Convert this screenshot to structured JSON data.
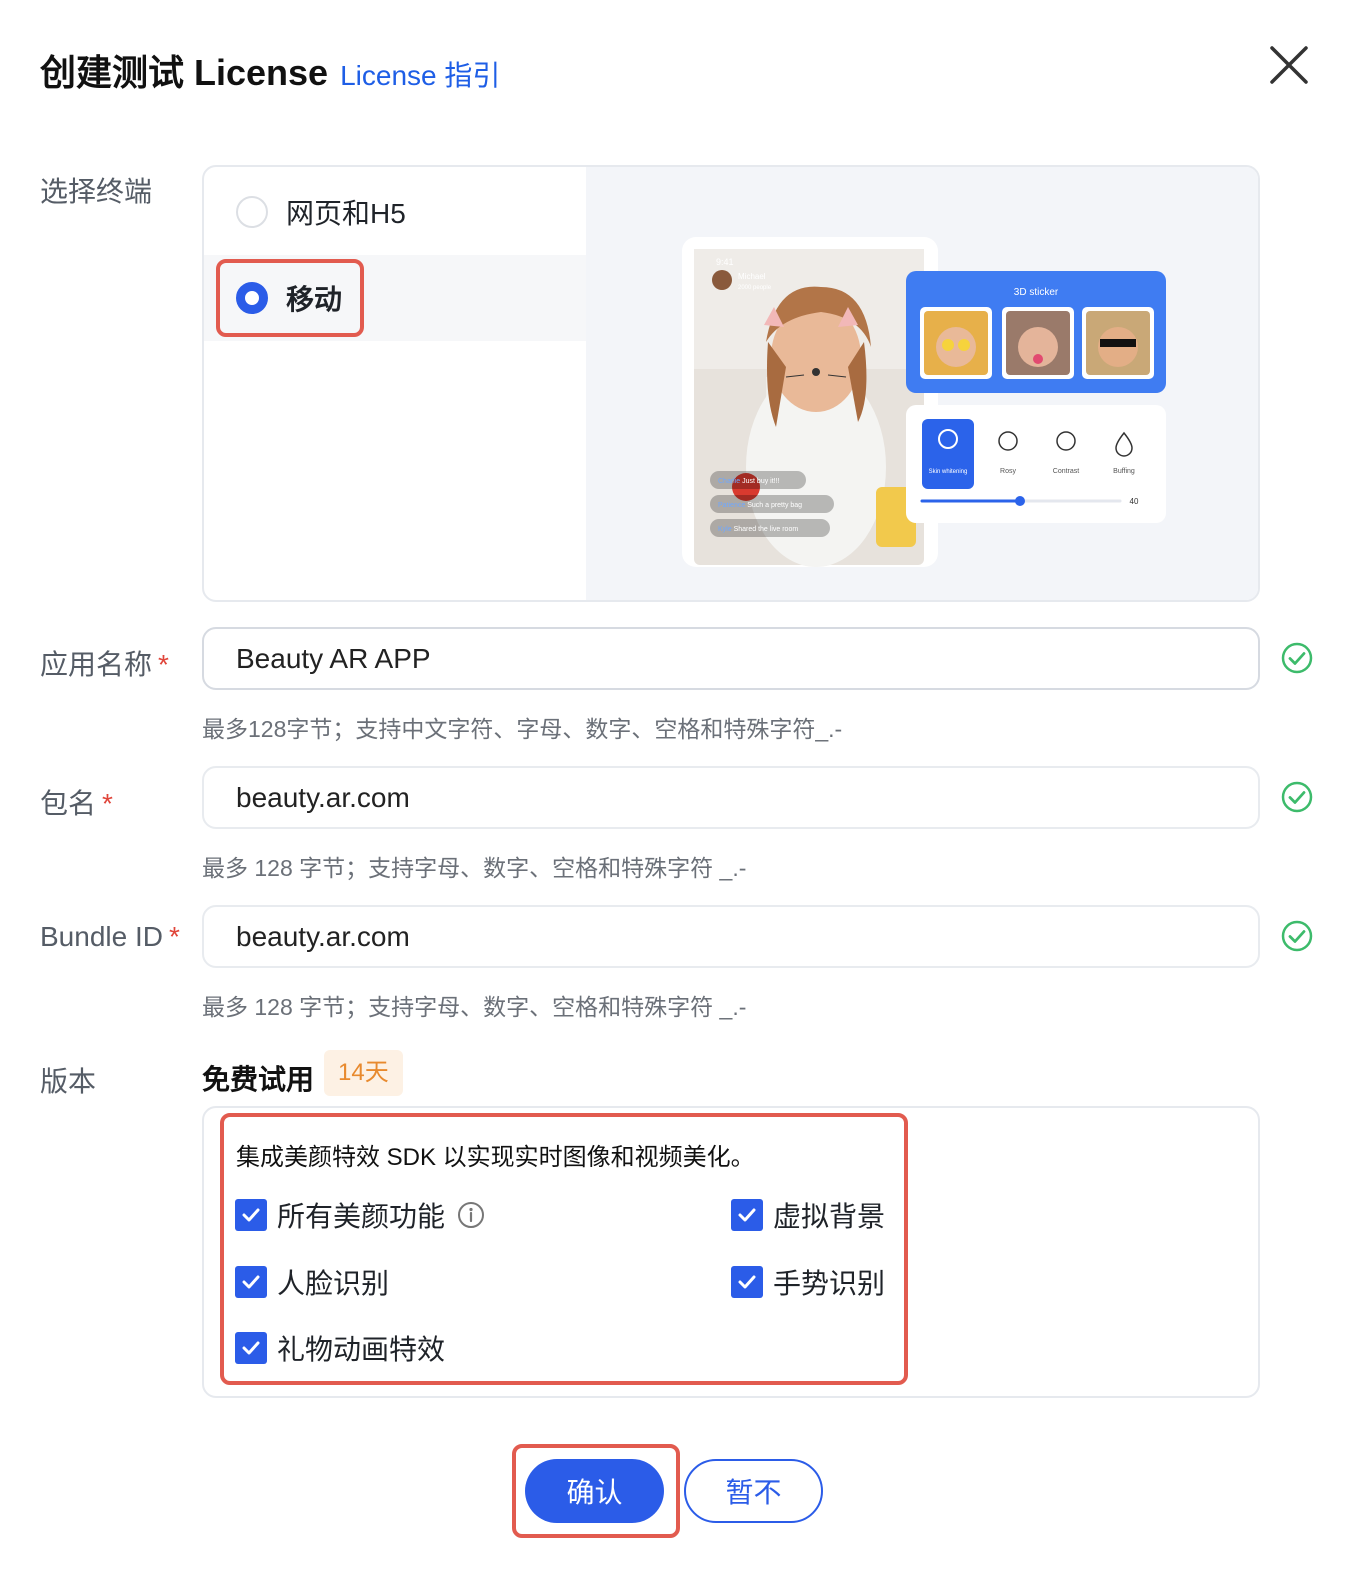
{
  "dialog": {
    "title": "创建测试 License",
    "guide_link": "License 指引"
  },
  "terminal": {
    "label": "选择终端",
    "options": [
      {
        "label": "网页和H5",
        "selected": false
      },
      {
        "label": "移动",
        "selected": true
      }
    ],
    "preview": {
      "status_time": "9:41",
      "streamer_name": "Michael",
      "viewers": "2000 people",
      "chat": [
        {
          "user": "Charlie",
          "text": "Just buy it!!!"
        },
        {
          "user": "Patience",
          "text": "Such a pretty bag"
        },
        {
          "user": "Kyle",
          "text": "Shared the live room"
        }
      ],
      "sticker_panel_title": "3D sticker",
      "beauty_tools": [
        "Skin whitening",
        "Rosy",
        "Contrast",
        "Buffing"
      ],
      "slider_value": "40"
    }
  },
  "fields": {
    "app_name": {
      "label": "应用名称",
      "required": "*",
      "value": "Beauty AR APP",
      "hint": "最多128字节；支持中文字符、字母、数字、空格和特殊字符_.-"
    },
    "package": {
      "label": "包名",
      "required": "*",
      "value": "beauty.ar.com",
      "hint": "最多 128 字节；支持字母、数字、空格和特殊字符 _.-"
    },
    "bundle": {
      "label": "Bundle ID",
      "required": "*",
      "value": "beauty.ar.com",
      "hint": "最多 128 字节；支持字母、数字、空格和特殊字符 _.-"
    }
  },
  "version": {
    "label": "版本",
    "plan": "免费试用",
    "badge": "14天",
    "description": "集成美颜特效 SDK 以实现实时图像和视频美化。",
    "features": [
      "所有美颜功能",
      "虚拟背景",
      "人脸识别",
      "手势识别",
      "礼物动画特效"
    ]
  },
  "actions": {
    "confirm": "确认",
    "cancel": "暂不"
  },
  "colors": {
    "primary": "#2b5ce8",
    "highlight": "#e25b4f",
    "success": "#3dbb6b"
  }
}
